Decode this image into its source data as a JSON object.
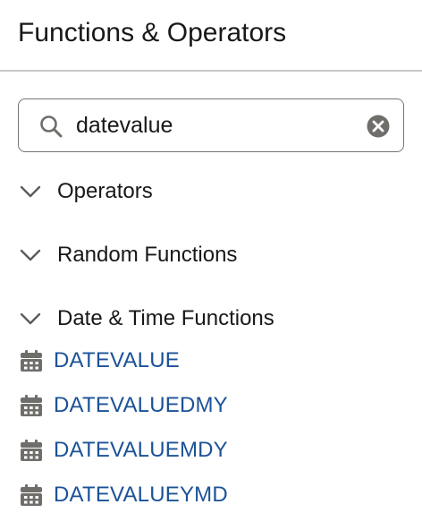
{
  "panel": {
    "title": "Functions & Operators"
  },
  "search": {
    "value": "datevalue",
    "search_icon": "search-icon",
    "clear_icon": "clear-icon"
  },
  "sections": [
    {
      "label": "Operators",
      "expanded": false,
      "icon": "chevron-down-icon"
    },
    {
      "label": "Random Functions",
      "expanded": false,
      "icon": "chevron-down-icon"
    },
    {
      "label": "Date & Time Functions",
      "expanded": true,
      "icon": "chevron-down-icon"
    }
  ],
  "functions": [
    {
      "label": "DATEVALUE",
      "icon": "calendar-icon"
    },
    {
      "label": "DATEVALUEDMY",
      "icon": "calendar-icon"
    },
    {
      "label": "DATEVALUEMDY",
      "icon": "calendar-icon"
    },
    {
      "label": "DATEVALUEYMD",
      "icon": "calendar-icon"
    }
  ],
  "colors": {
    "link": "#1b5297",
    "icon": "#706e6b",
    "text": "#181818",
    "divider": "#c9c9c9",
    "input_border": "#747474"
  }
}
